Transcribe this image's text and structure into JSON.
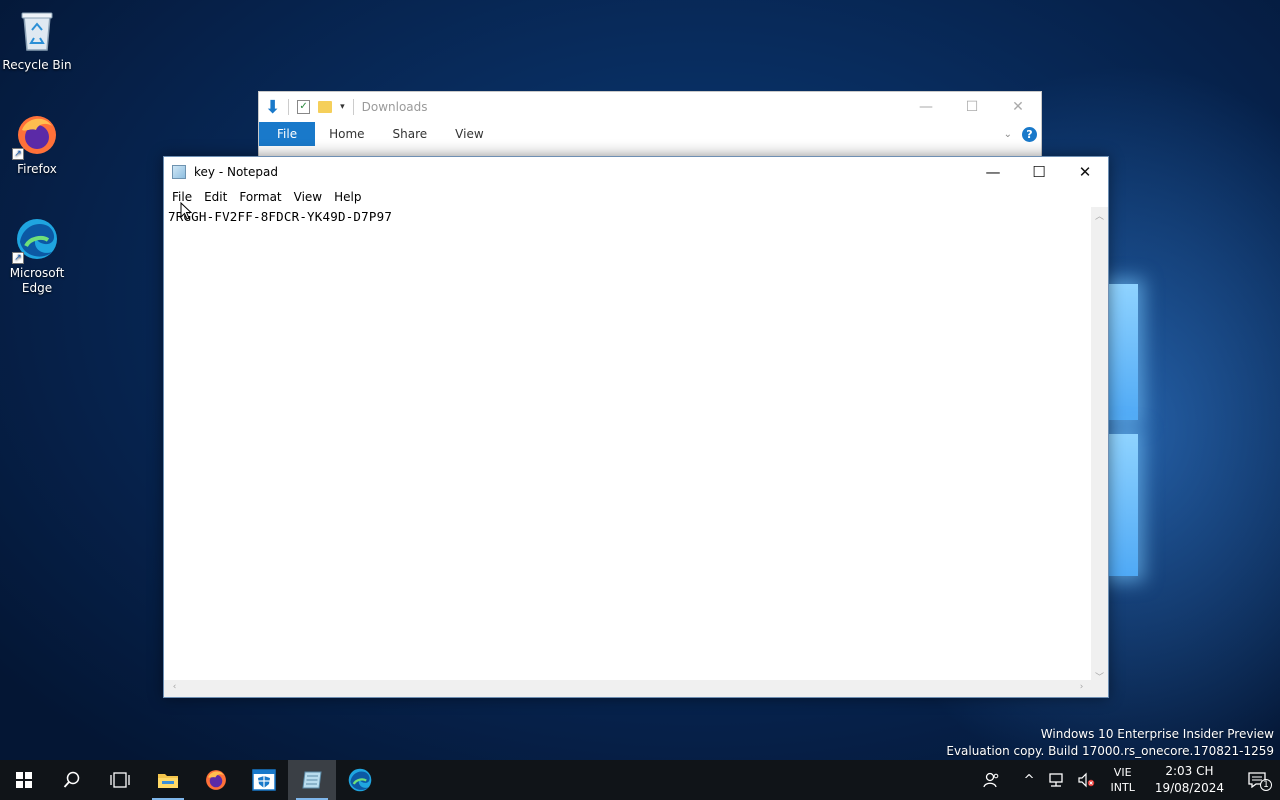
{
  "desktop": {
    "icons": [
      {
        "label": "Recycle Bin"
      },
      {
        "label": "Firefox"
      },
      {
        "label": "Microsoft Edge"
      }
    ]
  },
  "explorer": {
    "title": "Downloads",
    "tabs": [
      "File",
      "Home",
      "Share",
      "View"
    ],
    "help": "?"
  },
  "notepad": {
    "title": "key - Notepad",
    "menu": [
      "File",
      "Edit",
      "Format",
      "View",
      "Help"
    ],
    "content": "7RGGH-FV2FF-8FDCR-YK49D-D7P97"
  },
  "watermark": {
    "line1": "Windows 10 Enterprise Insider Preview",
    "line2": "Evaluation copy. Build 17000.rs_onecore.170821-1259"
  },
  "taskbar": {
    "lang_top": "VIE",
    "lang_bottom": "INTL",
    "time": "2:03 CH",
    "date": "19/08/2024",
    "notification_count": "1"
  },
  "colors": {
    "accent": "#1979ca",
    "taskbar": "#101418"
  }
}
